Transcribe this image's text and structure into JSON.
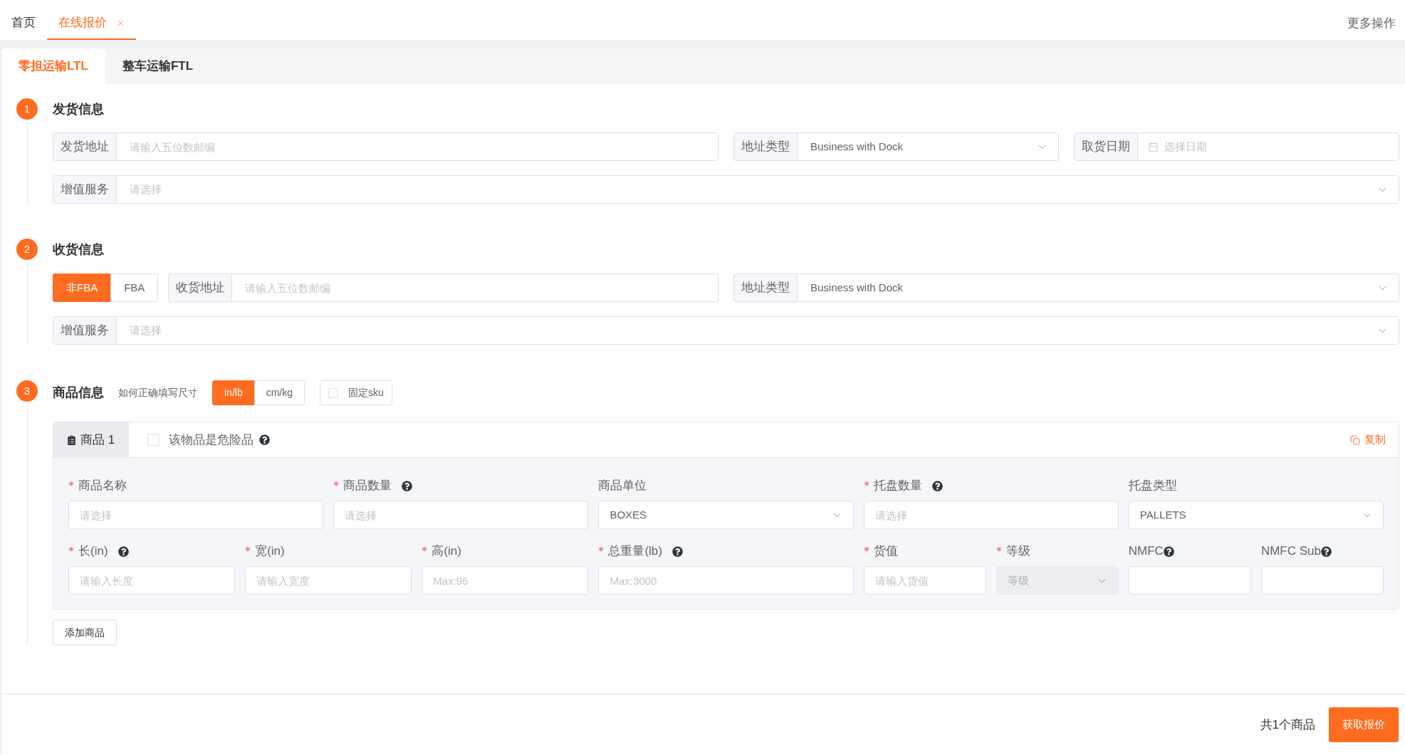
{
  "top_tabs": [
    {
      "label": "首页",
      "selected": false,
      "closable": false
    },
    {
      "label": "在线报价",
      "selected": true,
      "closable": true
    }
  ],
  "more_actions": "更多操作",
  "mode_tabs": [
    {
      "label": "零担运输LTL",
      "selected": true
    },
    {
      "label": "整车运输FTL",
      "selected": false
    }
  ],
  "shipper": {
    "step": "1",
    "title": "发货信息",
    "address": {
      "label": "发货地址",
      "placeholder": "请输入五位数邮编"
    },
    "address_type": {
      "label": "地址类型",
      "value": "Business with Dock"
    },
    "pickup_date": {
      "label": "取货日期",
      "placeholder": "选择日期"
    },
    "value_added": {
      "label": "增值服务",
      "placeholder": "请选择"
    }
  },
  "consignee": {
    "step": "2",
    "title": "收货信息",
    "fba_options": [
      {
        "label": "非FBA",
        "selected": true
      },
      {
        "label": "FBA",
        "selected": false
      }
    ],
    "address": {
      "label": "收货地址",
      "placeholder": "请输入五位数邮编"
    },
    "address_type": {
      "label": "地址类型",
      "value": "Business with Dock"
    },
    "value_added": {
      "label": "增值服务",
      "placeholder": "请选择"
    }
  },
  "goods": {
    "step": "3",
    "title": "商品信息",
    "size_help": "如何正确填写尺寸",
    "units": [
      {
        "label": "in/lb",
        "selected": true
      },
      {
        "label": "cm/kg",
        "selected": false
      }
    ],
    "fixed_sku": {
      "label": "固定sku",
      "checked": false
    },
    "items": [
      {
        "tab": "商品 1",
        "selected": true,
        "dangerous": {
          "label": "该物品是危险品",
          "checked": false,
          "help": true
        },
        "copy": "复制",
        "fields": [
          [
            {
              "kind": "input",
              "label": "商品名称",
              "required": true,
              "help": false,
              "disabled": false,
              "placeholder": "请选择"
            },
            {
              "kind": "input",
              "label": "商品数量",
              "required": true,
              "help": true,
              "disabled": false,
              "placeholder": "请选择"
            },
            {
              "kind": "select",
              "label": "商品单位",
              "required": false,
              "help": false,
              "disabled": false,
              "value": "BOXES"
            },
            {
              "kind": "input",
              "label": "托盘数量",
              "required": true,
              "help": true,
              "disabled": false,
              "placeholder": "请选择"
            },
            {
              "kind": "select",
              "label": "托盘类型",
              "required": false,
              "help": false,
              "disabled": false,
              "value": "PALLETS"
            }
          ],
          [
            {
              "kind": "input",
              "label": "长(in)",
              "required": true,
              "help": true,
              "disabled": false,
              "placeholder": "请输入长度"
            },
            {
              "kind": "input",
              "label": "宽(in)",
              "required": true,
              "help": false,
              "disabled": false,
              "placeholder": "请输入宽度"
            },
            {
              "kind": "input",
              "label": "高(in)",
              "required": true,
              "help": false,
              "disabled": false,
              "placeholder": "Max:96"
            },
            {
              "kind": "input",
              "label": "总重量(lb)",
              "required": true,
              "help": true,
              "disabled": false,
              "placeholder": "Max:3000"
            },
            {
              "kind": "input",
              "label": "货值",
              "required": true,
              "help": false,
              "disabled": false,
              "placeholder": "请输入货值"
            },
            {
              "kind": "select",
              "label": "等级",
              "required": true,
              "help": false,
              "disabled": true,
              "placeholder": "等级"
            },
            {
              "kind": "input",
              "label": "NMFC",
              "required": false,
              "help": true,
              "disabled": false
            },
            {
              "kind": "input",
              "label": "NMFC Sub",
              "required": false,
              "help": true,
              "disabled": false
            }
          ]
        ]
      }
    ],
    "add_button": "添加商品"
  },
  "footer": {
    "total": "共1个商品",
    "submit": "获取报价"
  }
}
